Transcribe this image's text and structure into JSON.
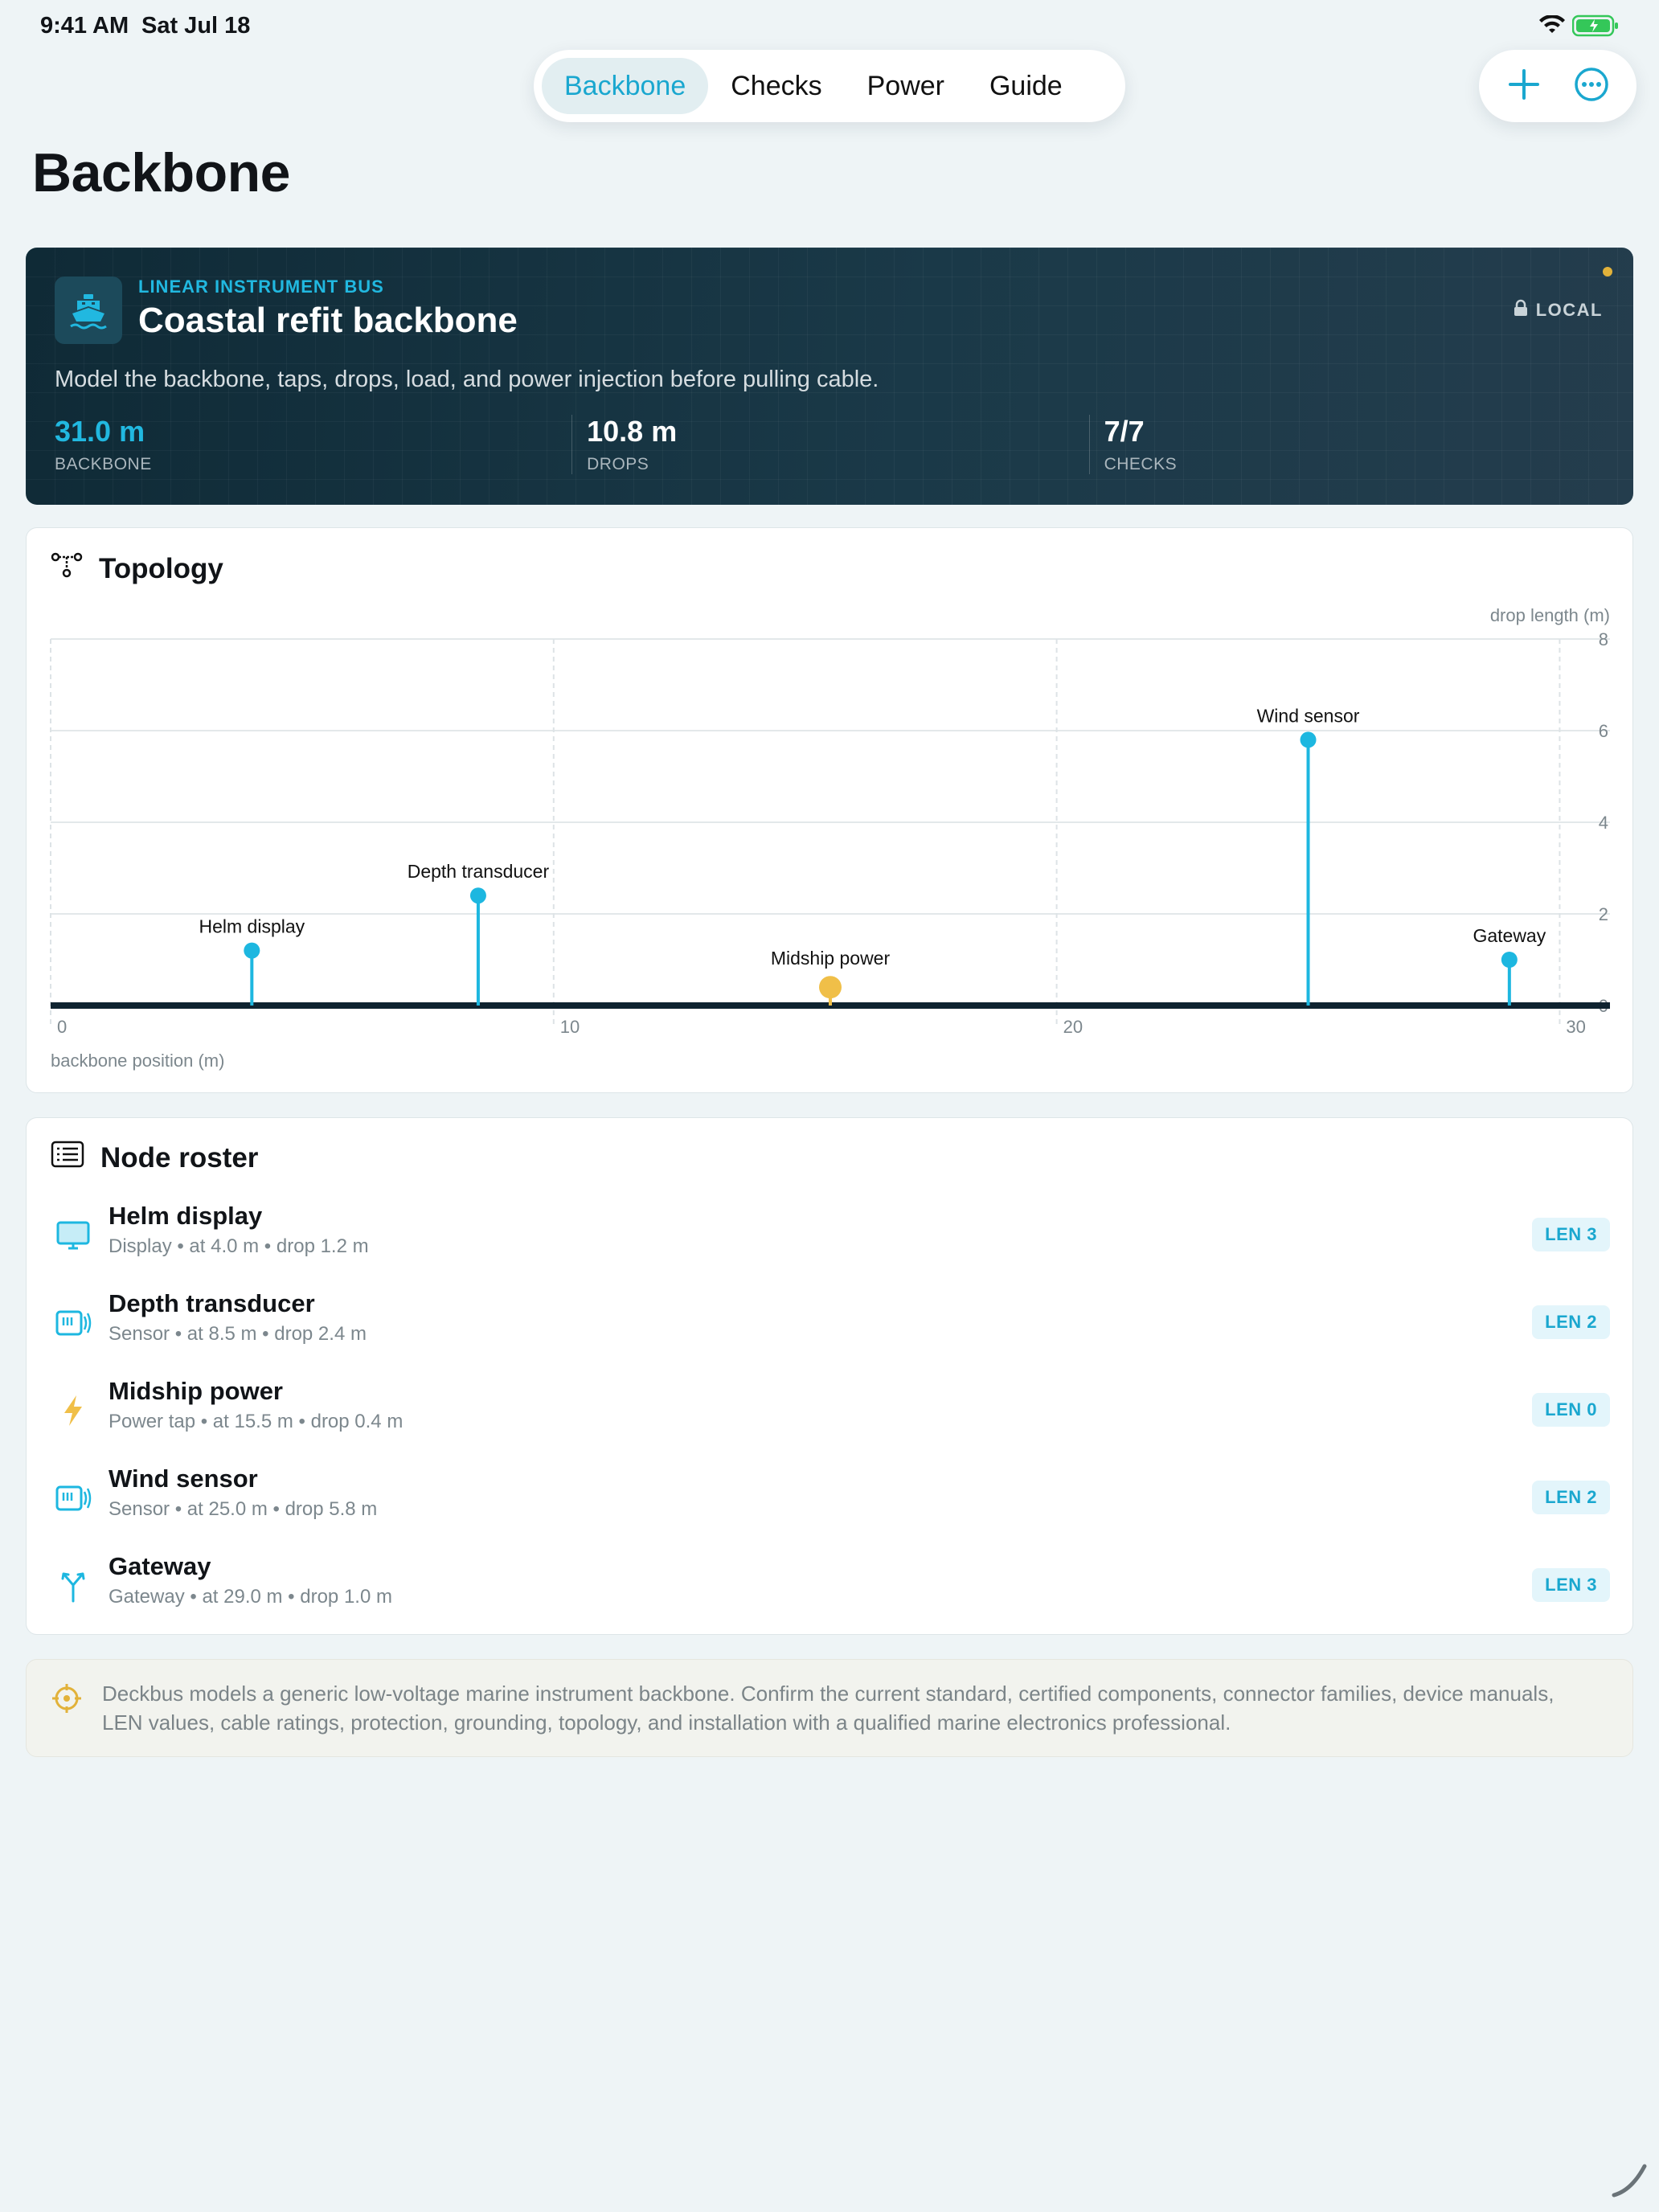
{
  "status": {
    "time": "9:41 AM",
    "date": "Sat Jul 18"
  },
  "tabs": [
    {
      "label": "Backbone",
      "active": true
    },
    {
      "label": "Checks",
      "active": false
    },
    {
      "label": "Power",
      "active": false
    },
    {
      "label": "Guide",
      "active": false
    }
  ],
  "toolbar": {
    "add_icon": "plus-icon",
    "more_icon": "ellipsis-circle-icon"
  },
  "page": {
    "title": "Backbone"
  },
  "hero": {
    "eyebrow": "LINEAR INSTRUMENT BUS",
    "title": "Coastal refit backbone",
    "local": "LOCAL",
    "description": "Model the backbone, taps, drops, load, and power injection before pulling cable.",
    "stats": [
      {
        "value": "31.0 m",
        "label": "BACKBONE"
      },
      {
        "value": "10.8 m",
        "label": "DROPS"
      },
      {
        "value": "7/7",
        "label": "CHECKS"
      }
    ]
  },
  "topology": {
    "title": "Topology",
    "chart_data": {
      "type": "scatter",
      "xlabel": "backbone position (m)",
      "ylabel": "drop length (m)",
      "xlim": [
        0,
        31
      ],
      "ylim": [
        0,
        8
      ],
      "xticks": [
        0,
        10,
        20,
        30
      ],
      "yticks": [
        0,
        2,
        4,
        6,
        8
      ],
      "points": [
        {
          "label": "Helm display",
          "x": 4.0,
          "y": 1.2,
          "kind": "device"
        },
        {
          "label": "Depth transducer",
          "x": 8.5,
          "y": 2.4,
          "kind": "device"
        },
        {
          "label": "Midship power",
          "x": 15.5,
          "y": 0.4,
          "kind": "power"
        },
        {
          "label": "Wind sensor",
          "x": 25.0,
          "y": 5.8,
          "kind": "device"
        },
        {
          "label": "Gateway",
          "x": 29.0,
          "y": 1.0,
          "kind": "device"
        }
      ],
      "colors": {
        "device": "#1db7e0",
        "power": "#f0bf48",
        "backbone": "#0f2330"
      }
    }
  },
  "roster": {
    "title": "Node roster",
    "items": [
      {
        "name": "Helm display",
        "meta": "Display • at 4.0 m • drop 1.2 m",
        "badge": "LEN 3",
        "icon": "display-icon"
      },
      {
        "name": "Depth transducer",
        "meta": "Sensor • at 8.5 m • drop 2.4 m",
        "badge": "LEN 2",
        "icon": "sensor-icon"
      },
      {
        "name": "Midship power",
        "meta": "Power tap • at 15.5 m • drop 0.4 m",
        "badge": "LEN 0",
        "icon": "bolt-icon"
      },
      {
        "name": "Wind sensor",
        "meta": "Sensor • at 25.0 m • drop 5.8 m",
        "badge": "LEN 2",
        "icon": "sensor-icon"
      },
      {
        "name": "Gateway",
        "meta": "Gateway • at 29.0 m • drop 1.0 m",
        "badge": "LEN 3",
        "icon": "gateway-icon"
      }
    ]
  },
  "notice": {
    "text": "Deckbus models a generic low-voltage marine instrument backbone. Confirm the current standard, certified components, connector families, device manuals, LEN values, cable ratings, protection, grounding, topology, and installation with a qualified marine electronics professional."
  },
  "colors": {
    "accent": "#1aa7cf",
    "power": "#f0bf48",
    "hero_bg": "#0f2a36"
  }
}
